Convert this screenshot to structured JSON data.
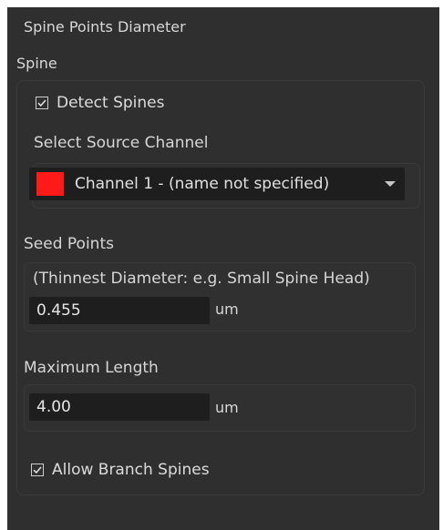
{
  "header": {
    "title": "Spine Points Diameter"
  },
  "spine": {
    "section_label": "Spine",
    "detect_spines": {
      "label": "Detect Spines",
      "checked": true
    },
    "source_channel": {
      "label": "Select Source Channel",
      "value": "Channel 1 - (name not specified)",
      "color": "#ff1a1a"
    },
    "seed_points": {
      "label": "Seed Points",
      "hint": "(Thinnest Diameter: e.g. Small Spine Head)",
      "value": "0.455",
      "unit": "um"
    },
    "max_length": {
      "label": "Maximum Length",
      "value": "4.00",
      "unit": "um"
    },
    "allow_branch": {
      "label": "Allow Branch Spines",
      "checked": true
    }
  }
}
